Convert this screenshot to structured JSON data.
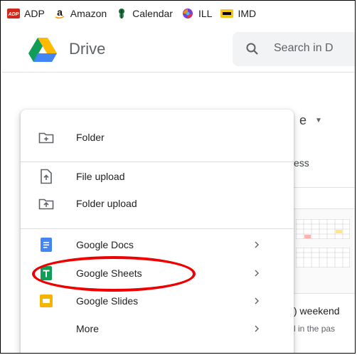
{
  "bookmarks": [
    {
      "label": "ADP",
      "icon": "adp-icon"
    },
    {
      "label": "Amazon",
      "icon": "amazon-icon"
    },
    {
      "label": "Calendar",
      "icon": "calendar-icon"
    },
    {
      "label": "ILL",
      "icon": "ill-icon"
    },
    {
      "label": "IMD",
      "icon": "imdb-icon"
    }
  ],
  "header": {
    "title": "Drive",
    "search_placeholder": "Search in D"
  },
  "background": {
    "my_drive_fragment": "e",
    "access_fragment": "ess",
    "file_title_fragment": ") weekend",
    "file_subtitle_fragment": "l in the pas"
  },
  "menu": {
    "items": [
      {
        "label": "Folder",
        "icon": "new-folder-icon"
      },
      {
        "label": "File upload",
        "icon": "file-upload-icon"
      },
      {
        "label": "Folder upload",
        "icon": "folder-upload-icon"
      },
      {
        "label": "Google Docs",
        "icon": "google-docs-icon"
      },
      {
        "label": "Google Sheets",
        "icon": "google-sheets-icon"
      },
      {
        "label": "Google Slides",
        "icon": "google-slides-icon"
      },
      {
        "label": "More",
        "icon": ""
      }
    ]
  },
  "colors": {
    "docs_blue": "#4285f4",
    "sheets_green": "#0f9d58",
    "slides_yellow": "#f4b400",
    "annotation_red": "#e00000"
  }
}
